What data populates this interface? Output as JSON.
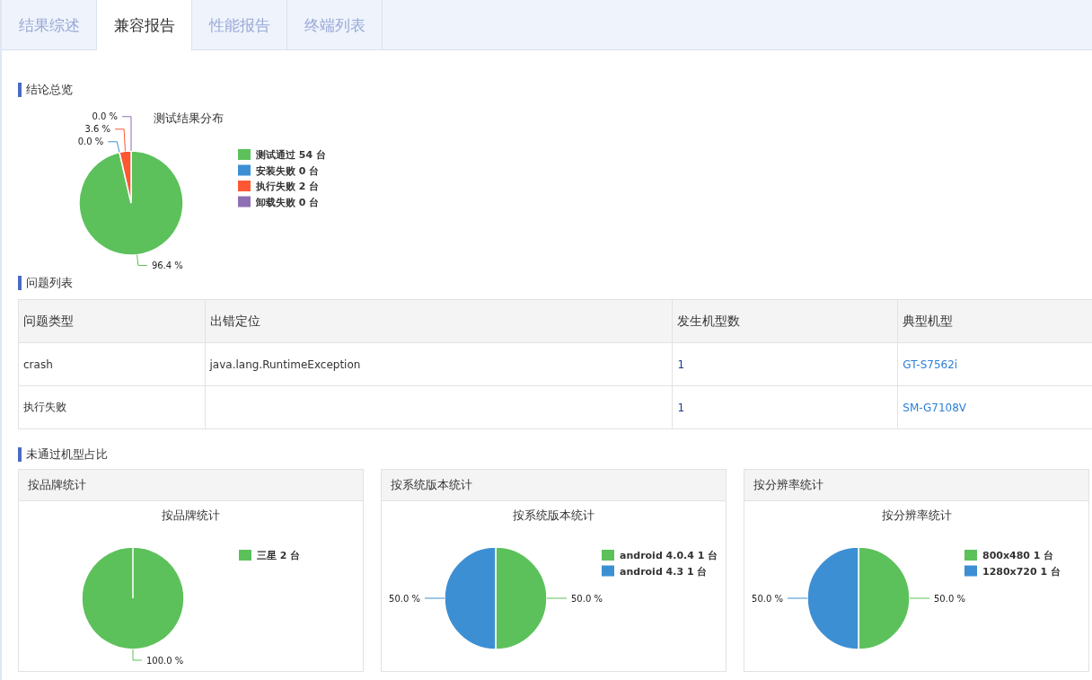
{
  "tabs": [
    {
      "label": "结果综述",
      "selected": false
    },
    {
      "label": "兼容报告",
      "selected": true
    },
    {
      "label": "性能报告",
      "selected": false
    },
    {
      "label": "终端列表",
      "selected": false
    }
  ],
  "summary": {
    "heading": "结论总览",
    "chart_data": {
      "type": "pie",
      "title": "测试结果分布",
      "categories": [
        "测试通过 54 台",
        "安装失败 0 台",
        "执行失败 2 台",
        "卸载失败 0 台"
      ],
      "values": [
        96.4,
        0,
        3.6,
        0
      ],
      "legend": "right",
      "colors": [
        "#5cc15b",
        "#3d8fd4",
        "#fe5733",
        "#8e6fb3"
      ],
      "value_labels": [
        "96.4 %",
        "0.0 %",
        "3.6 %",
        "0.0 %"
      ]
    }
  },
  "issues": {
    "heading": "问题列表",
    "columns": [
      "问题类型",
      "出错定位",
      "发生机型数",
      "典型机型"
    ],
    "rows": [
      [
        "crash",
        "java.lang.RuntimeException",
        "1",
        "GT-S7562i"
      ],
      [
        "执行失败",
        null,
        "1",
        "SM-G7108V"
      ]
    ]
  },
  "failed_share": {
    "heading": "未通过机型占比",
    "cards": [
      {
        "title": "按品牌统计",
        "chart_data": {
          "type": "pie",
          "title": "按品牌统计",
          "categories": [
            "三星 2 台"
          ],
          "values": [
            100
          ],
          "legend": "right",
          "colors": [
            "#5cc15b"
          ],
          "value_labels": [
            "100.0 %"
          ]
        }
      },
      {
        "title": "按系统版本统计",
        "chart_data": {
          "type": "pie",
          "title": "按系统版本统计",
          "categories": [
            "android 4.0.4 1 台",
            "android 4.3 1 台"
          ],
          "values": [
            50,
            50
          ],
          "legend": "right",
          "colors": [
            "#5cc15b",
            "#3d8fd4"
          ],
          "value_labels": [
            "50.0 %",
            "50.0 %"
          ]
        }
      },
      {
        "title": "按分辨率统计",
        "chart_data": {
          "type": "pie",
          "title": "按分辨率统计",
          "categories": [
            "800x480 1 台",
            "1280x720 1 台"
          ],
          "values": [
            50,
            50
          ],
          "legend": "right",
          "colors": [
            "#5cc15b",
            "#3d8fd4"
          ],
          "value_labels": [
            "50.0 %",
            "50.0 %"
          ]
        }
      }
    ]
  }
}
